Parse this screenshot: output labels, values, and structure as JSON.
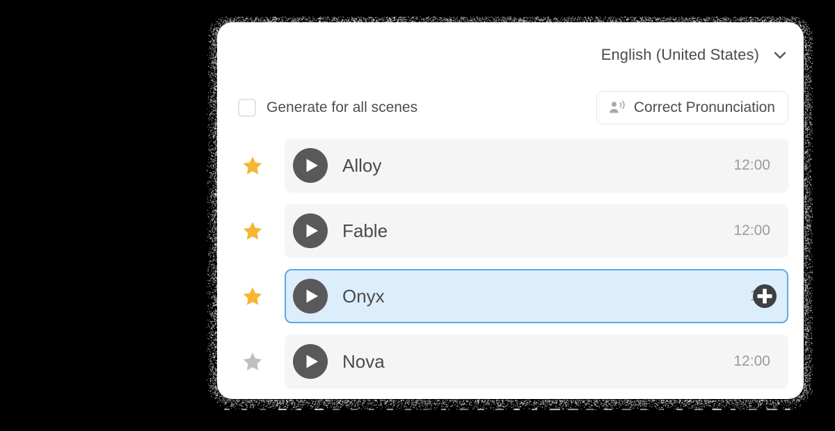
{
  "window": {
    "background_color": "#000000",
    "card_background": "#ffffff"
  },
  "language_selector": {
    "value": "English (United States)",
    "chevron_icon": "chevron-down-icon"
  },
  "options": {
    "generate_all_scenes": {
      "label": "Generate for all scenes",
      "checked": false
    },
    "correct_pronunciation": {
      "label": "Correct Pronunciation",
      "icon": "voice-person-icon"
    }
  },
  "voice_list": {
    "play_icon": "play-icon",
    "star_icon": "star-icon",
    "plus_icon": "plus-icon",
    "colors": {
      "star_active": "#f5b731",
      "star_inactive": "#bfbfbf",
      "play_circle": "#59595b",
      "row_background": "#f5f5f6",
      "selected_background": "#dcedfb",
      "selected_border": "#58aaea",
      "time_text": "#9a9a9e",
      "name_text": "#4a4a4a"
    },
    "rows": [
      {
        "name": "Alloy",
        "time": "12:00",
        "favorite": true,
        "selected": false
      },
      {
        "name": "Fable",
        "time": "12:00",
        "favorite": true,
        "selected": false
      },
      {
        "name": "Onyx",
        "time": "10:",
        "favorite": true,
        "selected": true
      },
      {
        "name": "Nova",
        "time": "12:00",
        "favorite": false,
        "selected": false
      }
    ]
  }
}
